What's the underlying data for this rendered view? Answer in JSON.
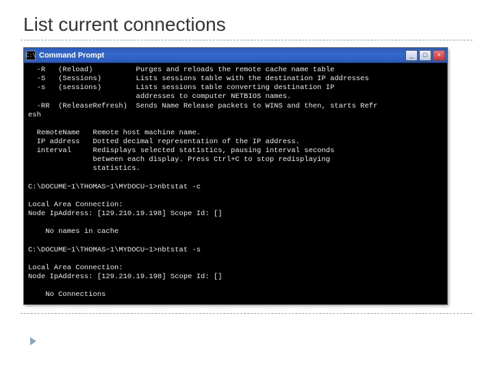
{
  "slide": {
    "title": "List current connections"
  },
  "window": {
    "title": "Command Prompt",
    "icon_glyph": "C:\\",
    "controls": {
      "minimize": "_",
      "maximize": "□",
      "close": "×"
    }
  },
  "terminal": {
    "options": [
      {
        "flag": "-R",
        "name": "(Reload)",
        "desc": "Purges and reloads the remote cache name table"
      },
      {
        "flag": "-S",
        "name": "(Sessions)",
        "desc": "Lists sessions table with the destination IP addresses"
      },
      {
        "flag": "-s",
        "name": "(sessions)",
        "desc": "Lists sessions table converting destination IP"
      },
      {
        "flag": "",
        "name": "",
        "desc": "addresses to computer NETBIOS names."
      },
      {
        "flag": "-RR",
        "name": "(ReleaseRefresh)",
        "desc": "Sends Name Release packets to WINS and then, starts Refr"
      }
    ],
    "wrap_tail": "esh",
    "params": [
      {
        "key": "RemoteName",
        "desc": "Remote host machine name."
      },
      {
        "key": "IP address",
        "desc": "Dotted decimal representation of the IP address."
      },
      {
        "key": "interval",
        "desc": "Redisplays selected statistics, pausing interval seconds"
      },
      {
        "key": "",
        "desc": "between each display. Press Ctrl+C to stop redisplaying"
      },
      {
        "key": "",
        "desc": "statistics."
      }
    ],
    "prompt": "C:\\DOCUME~1\\THOMAS~1\\MYDOCU~1>",
    "cmd1": "nbtstat -c",
    "out1": {
      "l1": "Local Area Connection:",
      "l2": "Node IpAddress: [129.210.19.198] Scope Id: []",
      "l3": "    No names in cache"
    },
    "cmd2": "nbtstat -s",
    "out2": {
      "l1": "Local Area Connection:",
      "l2": "Node IpAddress: [129.210.19.198] Scope Id: []",
      "l3": "    No Connections"
    }
  }
}
